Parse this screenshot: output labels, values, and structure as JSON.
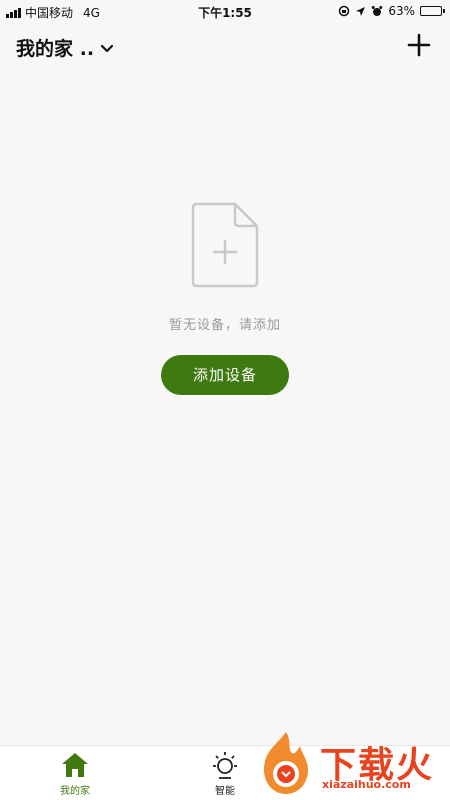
{
  "status_bar": {
    "carrier": "中国移动",
    "network": "4G",
    "time": "下午1:55",
    "battery_percent": "63%",
    "battery_level": 0.63
  },
  "header": {
    "home_name": "我的家 ..",
    "icons": {
      "dropdown": "chevron-down-icon",
      "add": "plus-icon"
    }
  },
  "empty_state": {
    "message": "暂无设备，请添加",
    "button_label": "添加设备",
    "icon": "add-file-icon"
  },
  "tabs": [
    {
      "label": "我的家",
      "icon": "home-icon",
      "active": true
    },
    {
      "label": "智能",
      "icon": "sun-icon",
      "active": false
    }
  ],
  "watermark": {
    "text": "下载火",
    "url_text": "xiazaihuo.com"
  },
  "colors": {
    "accent": "#3f7a10",
    "background": "#f7f7f7",
    "muted_text": "#9a9a9a",
    "watermark": "#e8421e"
  }
}
